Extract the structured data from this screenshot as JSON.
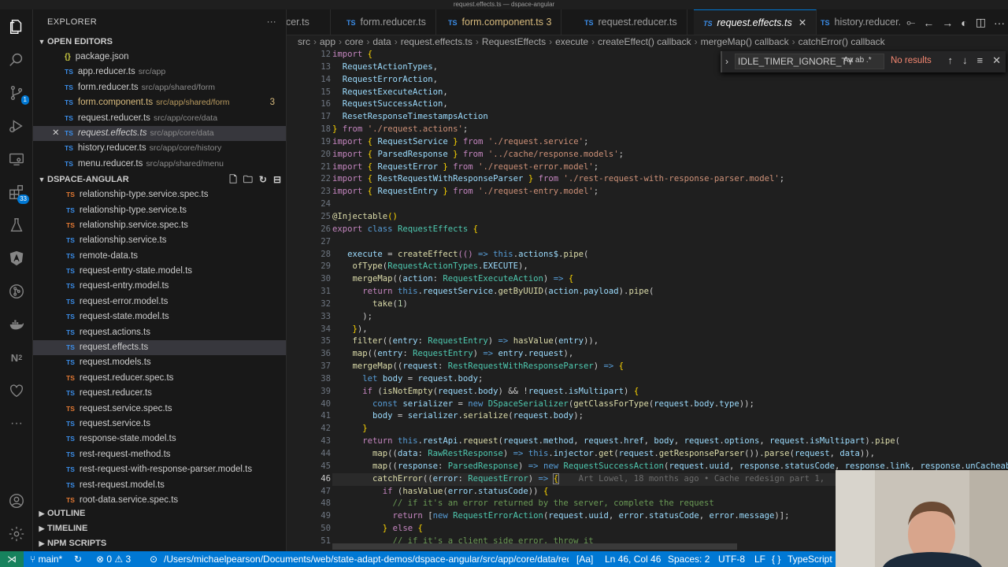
{
  "window": {
    "title": "request.effects.ts — dspace-angular"
  },
  "activity": {
    "items": [
      "files-icon",
      "search-icon",
      "source-control-icon",
      "run-debug-icon",
      "remote-explorer-icon",
      "extensions-icon",
      "testing-icon",
      "angular-icon",
      "git-graph-icon",
      "docker-icon",
      "nx-icon",
      "heart-icon",
      "more-icon"
    ],
    "badges": {
      "scm": "1",
      "ext": "33"
    }
  },
  "sidebar": {
    "title": "EXPLORER",
    "open_editors_label": "OPEN EDITORS",
    "open_editors": [
      {
        "name": "package.json",
        "path": "",
        "type": "json"
      },
      {
        "name": "app.reducer.ts",
        "path": "src/app",
        "type": "ts"
      },
      {
        "name": "form.reducer.ts",
        "path": "src/app/shared/form",
        "type": "ts"
      },
      {
        "name": "form.component.ts",
        "path": "src/app/shared/form",
        "type": "ts",
        "problems": "3"
      },
      {
        "name": "request.reducer.ts",
        "path": "src/app/core/data",
        "type": "ts"
      },
      {
        "name": "request.effects.ts",
        "path": "src/app/core/data",
        "type": "ts",
        "active": true
      },
      {
        "name": "history.reducer.ts",
        "path": "src/app/core/history",
        "type": "ts"
      },
      {
        "name": "menu.reducer.ts",
        "path": "src/app/shared/menu",
        "type": "ts"
      }
    ],
    "project_label": "DSPACE-ANGULAR",
    "files": [
      "relationship-type.service.spec.ts",
      "relationship-type.service.ts",
      "relationship.service.spec.ts",
      "relationship.service.ts",
      "remote-data.ts",
      "request-entry-state.model.ts",
      "request-entry.model.ts",
      "request-error.model.ts",
      "request-state.model.ts",
      "request.actions.ts",
      "request.effects.ts",
      "request.models.ts",
      "request.reducer.spec.ts",
      "request.reducer.ts",
      "request.service.spec.ts",
      "request.service.ts",
      "response-state.model.ts",
      "rest-request-method.ts",
      "rest-request-with-response-parser.model.ts",
      "rest-request.model.ts",
      "root-data.service.spec.ts"
    ],
    "selected_file": "request.effects.ts",
    "bottom_sections": [
      "OUTLINE",
      "TIMELINE",
      "NPM SCRIPTS"
    ]
  },
  "tabs": [
    {
      "label": "ucer.ts"
    },
    {
      "label": "form.reducer.ts"
    },
    {
      "label": "form.component.ts",
      "problems": "3"
    },
    {
      "label": "request.reducer.ts"
    },
    {
      "label": "request.effects.ts",
      "active": true
    },
    {
      "label": "history.reducer.ts"
    }
  ],
  "breadcrumb": [
    "src",
    "app",
    "core",
    "data",
    "request.effects.ts",
    "RequestEffects",
    "execute",
    "createEffect() callback",
    "mergeMap() callback",
    "catchError() callback"
  ],
  "find": {
    "query": "IDLE_TIMER_IGNORE_TY",
    "options": "Aa  ab  .*",
    "result": "No results"
  },
  "editor": {
    "line_numbers": [
      "12",
      "13",
      "14",
      "15",
      "16",
      "17",
      "18",
      "19",
      "20",
      "21",
      "22",
      "23",
      "24",
      "25",
      "26",
      "27",
      "28",
      "29",
      "30",
      "31",
      "32",
      "33",
      "34",
      "35",
      "36",
      "37",
      "38",
      "39",
      "40",
      "41",
      "42",
      "43",
      "44",
      "45",
      "46",
      "47",
      "48",
      "49",
      "50",
      "51"
    ],
    "current_line": "46",
    "blame": "Art Lowel, 18 months ago • Cache redesign part 1,"
  },
  "statusbar": {
    "branch": "main*",
    "errors": "0",
    "warnings": "3",
    "path": "/Users/michaelpearson/Documents/web/state-adapt-demos/dspace-angular/src/app/core/data/request.",
    "mode": "[Aa]",
    "position": "Ln 46, Col 46",
    "spaces": "Spaces: 2",
    "encoding": "UTF-8",
    "eol": "LF",
    "language": "TypeScript"
  }
}
